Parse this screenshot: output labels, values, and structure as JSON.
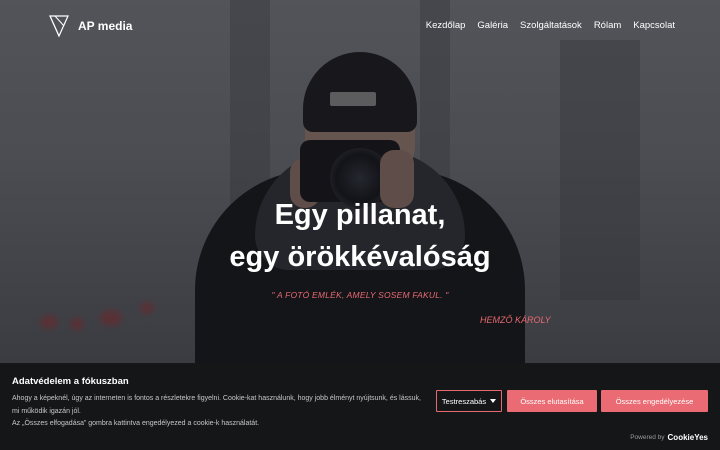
{
  "brand": {
    "name": "AP media",
    "logo_icon": "triangle-logo-icon"
  },
  "nav": {
    "items": [
      {
        "label": "Kezdőlap"
      },
      {
        "label": "Galéria"
      },
      {
        "label": "Szolgáltatások"
      },
      {
        "label": "Rólam"
      },
      {
        "label": "Kapcsolat"
      }
    ]
  },
  "hero": {
    "title_line1": "Egy pillanat,",
    "title_line2": "egy örökkévalóság",
    "quote": "\" A FOTÓ EMLÉK, AMELY SOSEM FAKUL. \"",
    "author": "HEMZŐ KÁROLY"
  },
  "cookie_banner": {
    "title": "Adatvédelem a fókuszban",
    "text_line1": "Ahogy a képeknél, úgy az interneten is fontos a részletekre figyelni. Cookie-kat használunk, hogy jobb élményt nyújtsunk, és lássuk, mi működik igazán jól.",
    "text_line2": "Az „Összes elfogadása” gombra kattintva engedélyezed a cookie-k használatát.",
    "customize_label": "Testreszabás",
    "reject_label": "Összes elutasítása",
    "accept_label": "Összes engedélyezése",
    "powered_by": "Powered by",
    "powered_brand": "CookieYes"
  },
  "colors": {
    "accent": "#ea6b73",
    "banner_bg": "#151618"
  }
}
